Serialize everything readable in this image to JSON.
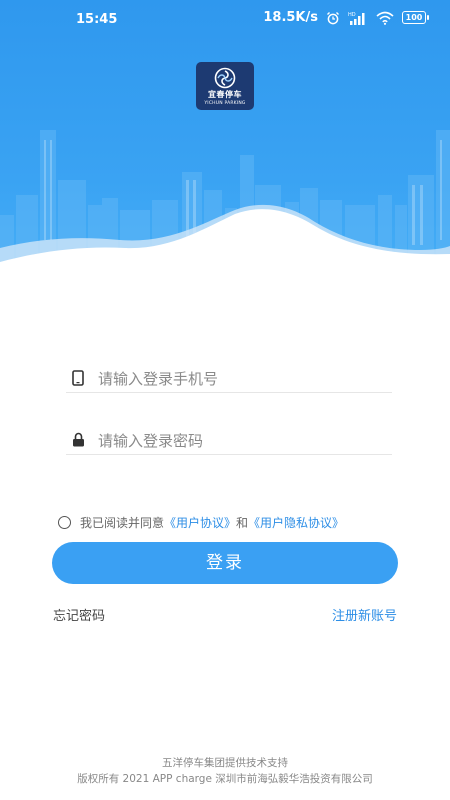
{
  "statusbar": {
    "time": "15:45",
    "net_speed": "18.5K/s",
    "battery": "100",
    "icons": [
      "alarm-icon",
      "hd-signal-icon",
      "wifi-icon",
      "battery-icon"
    ]
  },
  "app": {
    "logo_name": "宜春停车",
    "logo_sub": "YICHUN PARKING"
  },
  "login": {
    "phone_placeholder": "请输入登录手机号",
    "password_placeholder": "请输入登录密码",
    "agree_prefix": "我已阅读并同意",
    "user_agreement": "《用户协议》",
    "and": "和",
    "privacy_agreement": "《用户隐私协议》",
    "login_button": "登录",
    "forgot_password": "忘记密码",
    "register": "注册新账号"
  },
  "footer": {
    "line1": "五洋停车集团提供技术支持",
    "line2": "版权所有  2021 APP charge 深圳市前海弘毅华浩投资有限公司"
  },
  "colors": {
    "primary": "#3aa0f3",
    "header_top": "#2f98ee",
    "link": "#2d8ee6",
    "logo_bg": "#1d3a72"
  }
}
